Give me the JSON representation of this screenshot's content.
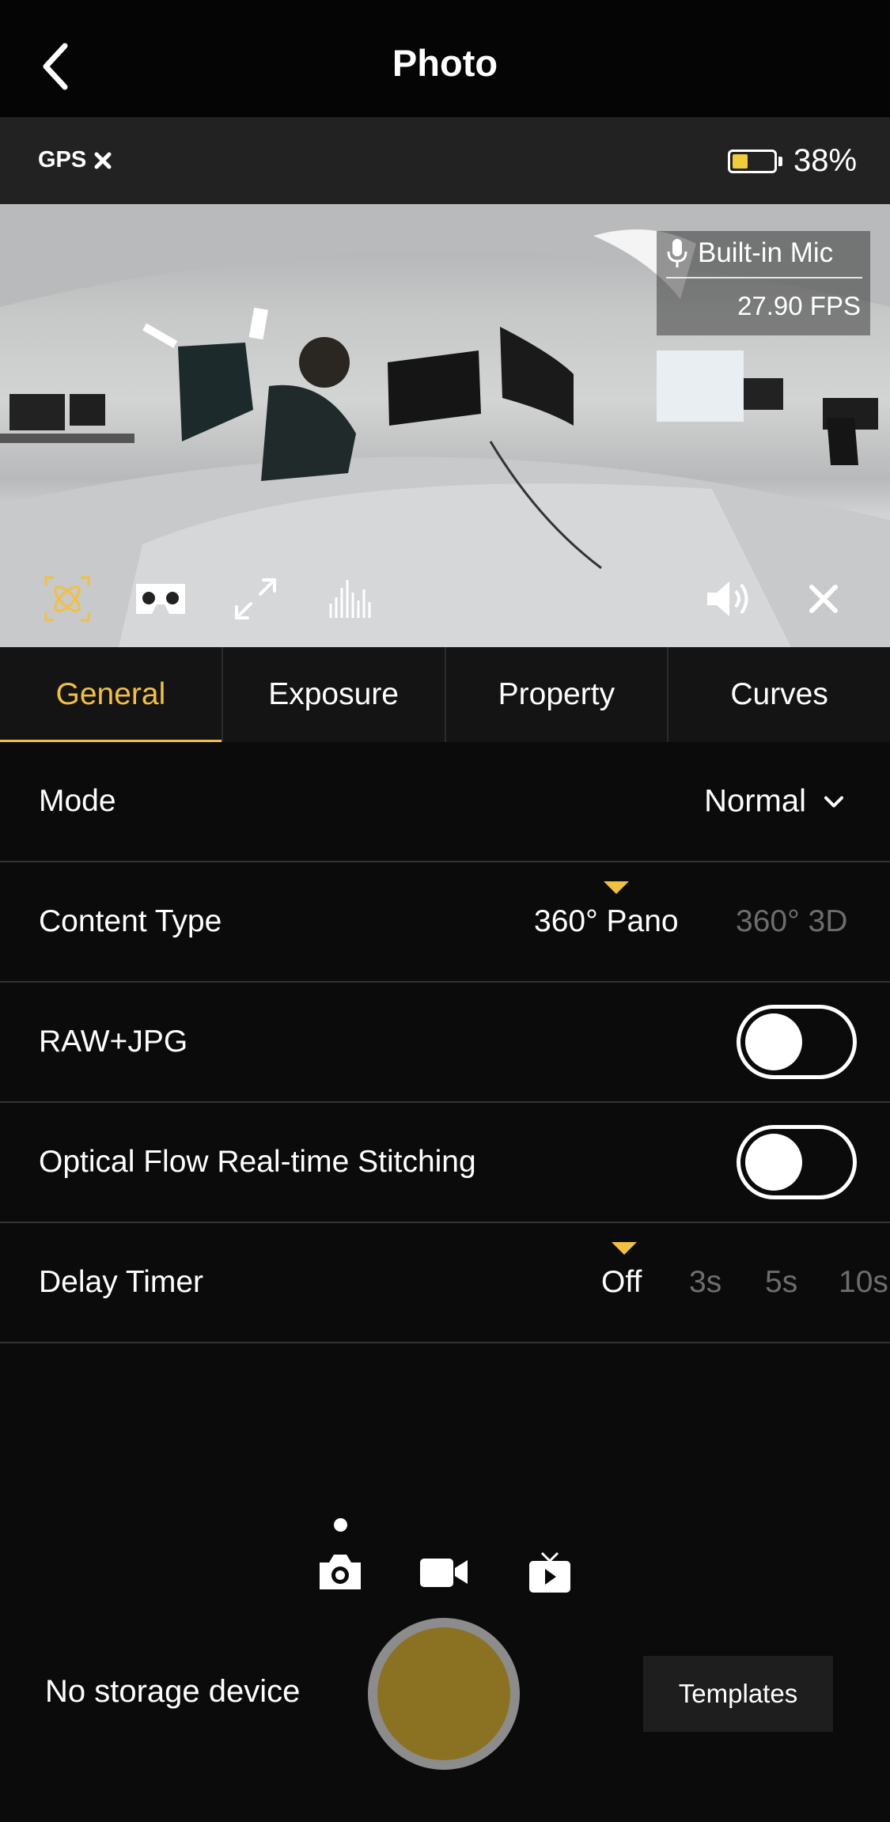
{
  "header": {
    "title": "Photo",
    "back_icon": "chevron-left-icon"
  },
  "status": {
    "gps_label": "GPS",
    "gps_state_icon": "x-icon",
    "battery_percent": "38%",
    "battery_level": 0.38,
    "battery_color": "#f2cb3b"
  },
  "preview": {
    "mic_label": "Built-in Mic",
    "fps": "27.90 FPS",
    "bottom_icons": [
      "stabilization-icon",
      "vr-headset-icon",
      "fullscreen-icon",
      "audio-level-icon",
      "volume-icon",
      "close-icon"
    ]
  },
  "tabs": [
    {
      "label": "General",
      "active": true
    },
    {
      "label": "Exposure",
      "active": false
    },
    {
      "label": "Property",
      "active": false
    },
    {
      "label": "Curves",
      "active": false
    }
  ],
  "settings": {
    "mode": {
      "label": "Mode",
      "value": "Normal"
    },
    "content_type": {
      "label": "Content Type",
      "selected": "360° Pano",
      "next": "360° 3D"
    },
    "raw_jpg": {
      "label": "RAW+JPG",
      "on": false
    },
    "optical_flow": {
      "label": "Optical Flow Real-time Stitching",
      "on": false
    },
    "delay_timer": {
      "label": "Delay Timer",
      "options": [
        "Off",
        "3s",
        "5s",
        "10s"
      ],
      "selected": "Off"
    }
  },
  "bottom": {
    "modes": [
      "photo-camera-icon",
      "video-camera-icon",
      "live-stream-icon"
    ],
    "selected_mode": "photo",
    "storage_text": "No storage device",
    "templates_label": "Templates",
    "shutter_color": "#8b7223"
  },
  "colors": {
    "accent": "#f2c040",
    "background": "#0b0b0b"
  }
}
